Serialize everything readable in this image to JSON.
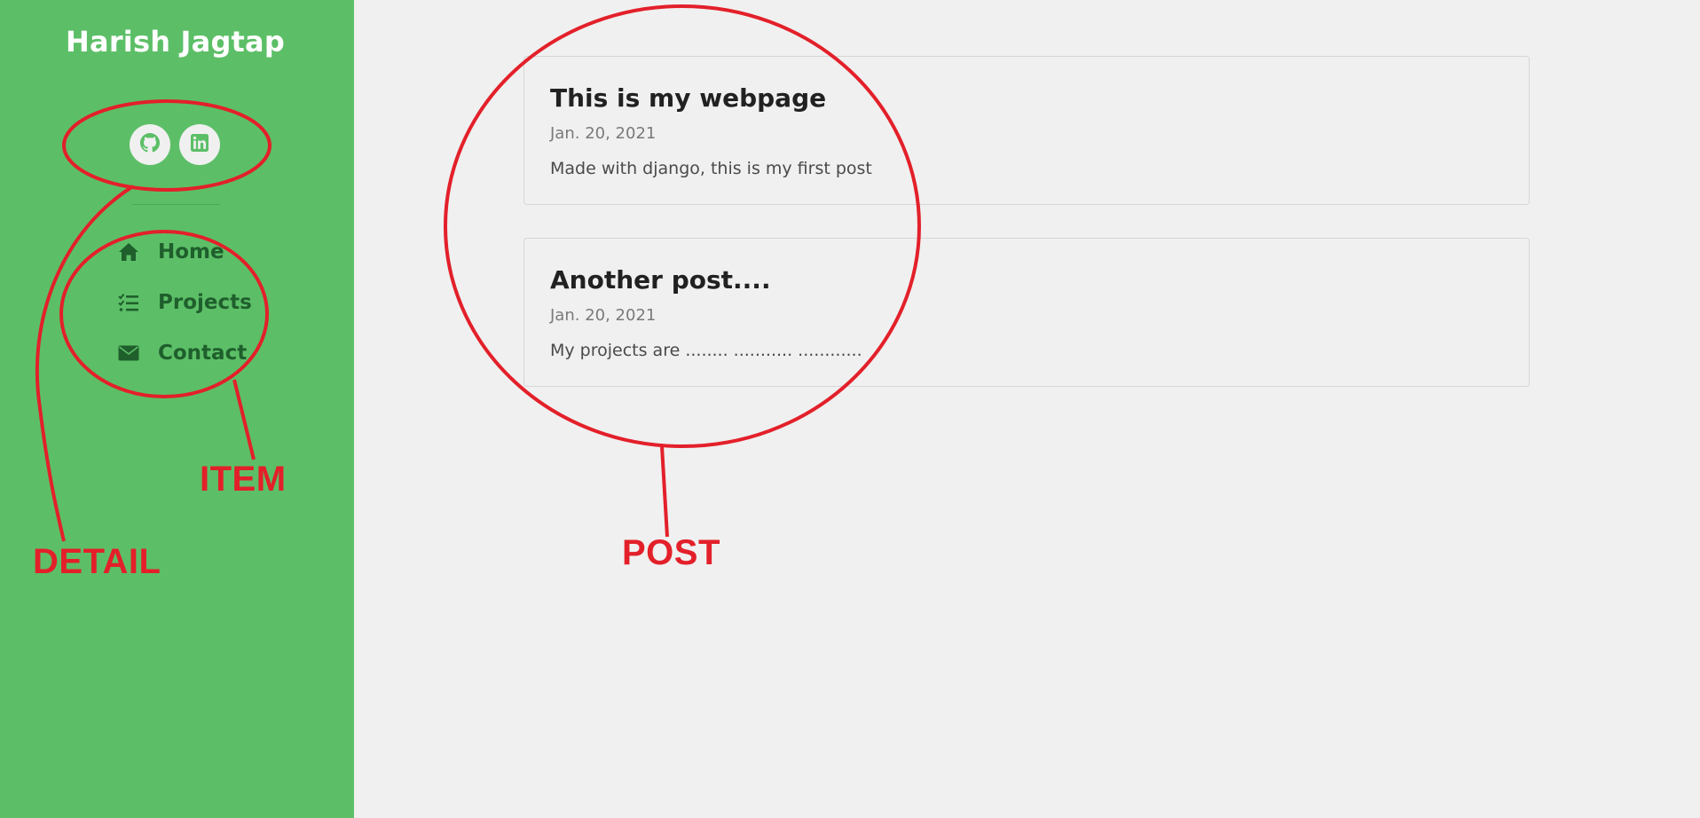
{
  "sidebar": {
    "title": "Harish Jagtap",
    "background_color": "#5cbf67",
    "social": [
      {
        "name": "github-icon",
        "color": "#5cbf67"
      },
      {
        "name": "linkedin-icon",
        "color": "#5cbf67"
      }
    ],
    "nav": [
      {
        "label": "Home",
        "icon": "home-icon"
      },
      {
        "label": "Projects",
        "icon": "tasks-icon"
      },
      {
        "label": "Contact",
        "icon": "envelope-icon"
      }
    ],
    "nav_text_color": "#1f5f2c"
  },
  "posts": [
    {
      "title": "This is my webpage",
      "date": "Jan. 20, 2021",
      "body": "Made with django, this is my first post"
    },
    {
      "title": "Another post....",
      "date": "Jan. 20, 2021",
      "body": "My projects are ........ ........... ............"
    }
  ],
  "annotations": {
    "color": "#e3202a",
    "item_label": "ITEM",
    "detail_label": "DETAIL",
    "post_label": "POST"
  }
}
